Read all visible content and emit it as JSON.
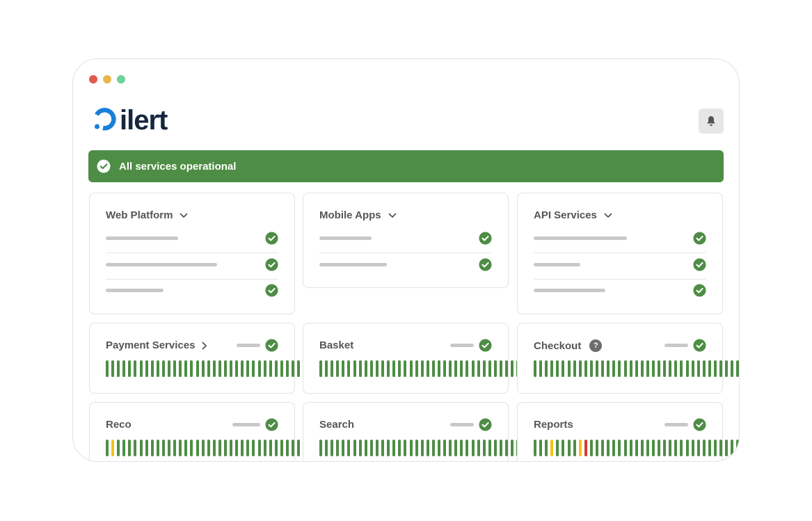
{
  "window": {
    "dots": [
      "#e05a4f",
      "#e6b84a",
      "#6dd39a"
    ]
  },
  "logo": {
    "text": "ilert",
    "brand_color": "#1a7fd9",
    "text_color": "#15263e"
  },
  "header": {
    "notification_icon": "bell-icon"
  },
  "banner": {
    "text": "All services operational",
    "color": "#4e8d45",
    "icon": "check-circle-icon"
  },
  "colors": {
    "ok": "#4e8d45",
    "warn": "#f3c21b",
    "error": "#d43a2e",
    "placeholder": "#c8c8c8"
  },
  "groups": [
    {
      "title": "Web Platform",
      "rows": 3
    },
    {
      "title": "Mobile Apps",
      "rows": 2
    },
    {
      "title": "API Services",
      "rows": 3
    }
  ],
  "services": [
    {
      "title": "Payment Services",
      "status": "ok",
      "bars": "ggggggggggggggggggggggggggggggggggggg"
    },
    {
      "title": "Basket",
      "status": "ok",
      "bars": "ggggggggggggggggggggggggggggggggggggg"
    },
    {
      "title": "Checkout",
      "status": "ok",
      "help": "?",
      "bars": "ggggggggggggggggggggggggggggggggggggg"
    },
    {
      "title": "Reco",
      "status": "ok",
      "bars": "gyggggggggggggggggggggggggggggggggggg"
    },
    {
      "title": "Search",
      "status": "ok",
      "bars": "ggggggggggggggggggggggggggggggggggggg"
    },
    {
      "title": "Reports",
      "status": "ok",
      "bars": "gggyggggyrggggggggggggggggggggggggggg"
    }
  ]
}
